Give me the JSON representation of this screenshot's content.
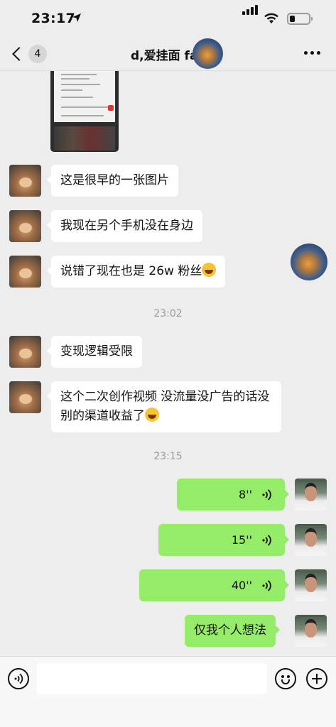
{
  "status_bar": {
    "time": "23:17"
  },
  "nav": {
    "unread_count": "4",
    "title": "d,爱挂面 fa"
  },
  "messages": [
    {
      "side": "other",
      "text": "这是很早的一张图片"
    },
    {
      "side": "other",
      "text": "我现在另个手机没在身边"
    },
    {
      "side": "other",
      "text": "说错了现在也是 26w 粉丝",
      "emoji": "laugh-cry-emoji"
    },
    {
      "side": "other",
      "text": "变现逻辑受限"
    },
    {
      "side": "other",
      "text": "这个二次创作视频  没流量没广告的话没别的渠道收益了",
      "emoji": "laugh-cry-emoji"
    },
    {
      "side": "me",
      "type": "voice",
      "duration": "8''"
    },
    {
      "side": "me",
      "type": "voice",
      "duration": "15''"
    },
    {
      "side": "me",
      "type": "voice",
      "duration": "40''"
    },
    {
      "side": "me",
      "text": "仅我个人想法"
    }
  ],
  "timestamps": [
    "23:02",
    "23:15"
  ],
  "colors": {
    "background": "#ededed",
    "my_bubble": "#95ec69",
    "other_bubble": "#ffffff"
  }
}
